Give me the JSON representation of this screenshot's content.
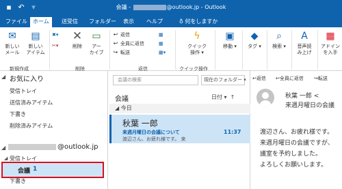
{
  "titlebar": {
    "title_prefix": "会議 - ",
    "title_suffix": "@outlook.jp - Outlook",
    "icons": {
      "save": "save-icon",
      "undo": "undo-icon",
      "redo": "redo-icon"
    }
  },
  "tabs": [
    "ファイル",
    "ホーム",
    "送受信",
    "フォルダー",
    "表示",
    "ヘルプ",
    "何をしますか"
  ],
  "active_tab": "ホーム",
  "ribbon": {
    "new_mail": [
      "新しい",
      "メール"
    ],
    "new_item": [
      "新しい",
      "アイテム"
    ],
    "group_new": "新規作成",
    "delete": "削除",
    "archive": [
      "アー",
      "カイブ"
    ],
    "group_delete": "削除",
    "reply": "返信",
    "reply_all": "全員に返信",
    "forward": "転送",
    "group_respond": "返信",
    "quick_steps": [
      "クイック",
      "操作"
    ],
    "group_quick": "クイック操作",
    "move": "移動",
    "tags": "タグ",
    "search": "検索",
    "read_aloud": [
      "音声読",
      "み上げ"
    ],
    "addins": [
      "アドイン",
      "を入手"
    ]
  },
  "sidebar": {
    "favorites_header": "お気に入り",
    "favorites": [
      "受信トレイ",
      "送信済みアイテム",
      "下書き",
      "削除済みアイテム"
    ],
    "account_suffix": "@outlook.jp",
    "inbox": "受信トレイ",
    "selected_folder": "会議",
    "selected_count": "1",
    "drafts": "下書き"
  },
  "middle": {
    "search_placeholder": "会議の検索",
    "search_scope": "現在のフォルダー",
    "folder_name": "会議",
    "sort_label": "日付",
    "group_today": "今日",
    "mail": {
      "from": "秋葉 一郎",
      "subject": "来週月曜日の会議について",
      "time": "11:37",
      "preview": "渡辺さん、お疲れ様です。 来"
    }
  },
  "reading": {
    "actions": [
      "返信",
      "全員に返信",
      "転送"
    ],
    "from": "秋葉 一郎 <",
    "subject": "来週月曜日の会議",
    "body": [
      "渡辺さん、お疲れ様です。",
      "来週月曜日の会議ですが、",
      "議室を予約しました。",
      "よろしくお願いします。"
    ]
  },
  "colors": {
    "accent": "#0f63ad",
    "selected_bg": "#cde4f7",
    "highlight_border": "#d7101e"
  }
}
